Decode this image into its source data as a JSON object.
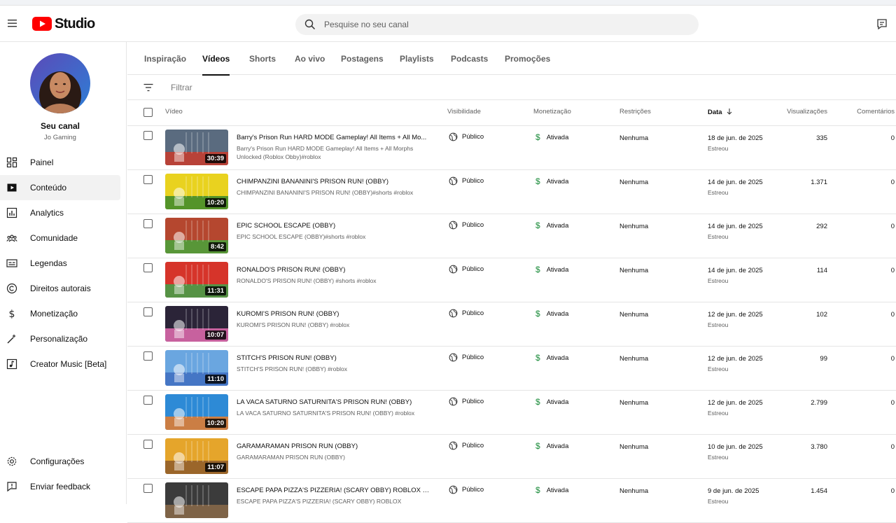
{
  "app": {
    "name": "Studio"
  },
  "search": {
    "placeholder": "Pesquise no seu canal"
  },
  "channel": {
    "title": "Seu canal",
    "name": "Jo Gaming"
  },
  "nav": [
    {
      "label": "Painel",
      "icon": "dashboard-icon"
    },
    {
      "label": "Conteúdo",
      "icon": "content-icon"
    },
    {
      "label": "Analytics",
      "icon": "analytics-icon"
    },
    {
      "label": "Comunidade",
      "icon": "community-icon"
    },
    {
      "label": "Legendas",
      "icon": "subtitles-icon"
    },
    {
      "label": "Direitos autorais",
      "icon": "copyright-icon"
    },
    {
      "label": "Monetização",
      "icon": "dollar-icon"
    },
    {
      "label": "Personalização",
      "icon": "magic-wand-icon"
    },
    {
      "label": "Creator Music [Beta]",
      "icon": "music-icon"
    }
  ],
  "nav_bottom": [
    {
      "label": "Configurações",
      "icon": "gear-icon"
    },
    {
      "label": "Enviar feedback",
      "icon": "feedback-icon"
    }
  ],
  "tabs": [
    "Inspiração",
    "Vídeos",
    "Shorts",
    "Ao vivo",
    "Postagens",
    "Playlists",
    "Podcasts",
    "Promoções"
  ],
  "active_tab": "Vídeos",
  "filter": {
    "placeholder": "Filtrar"
  },
  "columns": {
    "video": "Vídeo",
    "visibility": "Visibilidade",
    "monetization": "Monetização",
    "restrictions": "Restrições",
    "date": "Data",
    "views": "Visualizações",
    "comments": "Comentários"
  },
  "videos": [
    {
      "title": "Barry's Prison Run HARD MODE Gameplay! All Items + All Mo...",
      "desc": "Barry's Prison Run HARD MODE Gameplay! All Items + All Morphs Unlocked (Roblox Obby)#roblox",
      "duration": "30:39",
      "visibility": "Público",
      "monetization": "Ativada",
      "restrictions": "Nenhuma",
      "date": "18 de jun. de 2025",
      "date_sub": "Estreou",
      "views": "335",
      "comments": "0",
      "colors": [
        "#5a6b7f",
        "#c93b2b"
      ]
    },
    {
      "title": "CHIMPANZINI BANANINI'S PRISON RUN! (OBBY)",
      "desc": "CHIMPANZINI BANANINI'S PRISON RUN! (OBBY)#shorts #roblox",
      "duration": "10:20",
      "visibility": "Público",
      "monetization": "Ativada",
      "restrictions": "Nenhuma",
      "date": "14 de jun. de 2025",
      "date_sub": "Estreou",
      "views": "1.371",
      "comments": "0",
      "colors": [
        "#e9d21f",
        "#3a8a2c"
      ]
    },
    {
      "title": "EPIC SCHOOL ESCAPE (OBBY)",
      "desc": "EPIC SCHOOL ESCAPE (OBBY)#shorts #roblox",
      "duration": "8:42",
      "visibility": "Público",
      "monetization": "Ativada",
      "restrictions": "Nenhuma",
      "date": "14 de jun. de 2025",
      "date_sub": "Estreou",
      "views": "292",
      "comments": "0",
      "colors": [
        "#b5472f",
        "#48a53a"
      ]
    },
    {
      "title": "RONALDO'S PRISON RUN! (OBBY)",
      "desc": "RONALDO'S PRISON RUN! (OBBY) #shorts #roblox",
      "duration": "11:31",
      "visibility": "Público",
      "monetization": "Ativada",
      "restrictions": "Nenhuma",
      "date": "14 de jun. de 2025",
      "date_sub": "Estreou",
      "views": "114",
      "comments": "0",
      "colors": [
        "#d6342a",
        "#3fa34a"
      ]
    },
    {
      "title": "KUROMI'S PRISON RUN! (OBBY)",
      "desc": "KUROMI'S PRISON RUN! (OBBY) #roblox",
      "duration": "10:07",
      "visibility": "Público",
      "monetization": "Ativada",
      "restrictions": "Nenhuma",
      "date": "12 de jun. de 2025",
      "date_sub": "Estreou",
      "views": "102",
      "comments": "0",
      "colors": [
        "#2b2438",
        "#e36cb0"
      ]
    },
    {
      "title": "STITCH'S PRISON RUN! (OBBY)",
      "desc": "STITCH'S PRISON RUN! (OBBY) #roblox",
      "duration": "11:10",
      "visibility": "Público",
      "monetization": "Ativada",
      "restrictions": "Nenhuma",
      "date": "12 de jun. de 2025",
      "date_sub": "Estreou",
      "views": "99",
      "comments": "0",
      "colors": [
        "#6aa6e0",
        "#3e6dc0"
      ]
    },
    {
      "title": "LA VACA SATURNO SATURNITA'S PRISON RUN! (OBBY)",
      "desc": "LA VACA SATURNO SATURNITA'S PRISON RUN! (OBBY) #roblox",
      "duration": "10:20",
      "visibility": "Público",
      "monetization": "Ativada",
      "restrictions": "Nenhuma",
      "date": "12 de jun. de 2025",
      "date_sub": "Estreou",
      "views": "2.799",
      "comments": "0",
      "colors": [
        "#2d8ad6",
        "#e77b2a"
      ]
    },
    {
      "title": "GARAMARAMAN PRISON RUN (OBBY)",
      "desc": "GARAMARAMAN PRISON RUN (OBBY)",
      "duration": "11:07",
      "visibility": "Público",
      "monetization": "Ativada",
      "restrictions": "Nenhuma",
      "date": "10 de jun. de 2025",
      "date_sub": "Estreou",
      "views": "3.780",
      "comments": "0",
      "colors": [
        "#e5a52b",
        "#8e5a2a"
      ]
    },
    {
      "title": "ESCAPE PAPA PIZZA'S PIZZERIA! (SCARY OBBY) ROBLOX GA...",
      "desc": "ESCAPE PAPA PIZZA'S PIZZERIA! (SCARY OBBY) ROBLOX",
      "duration": "",
      "visibility": "Público",
      "monetization": "Ativada",
      "restrictions": "Nenhuma",
      "date": "9 de jun. de 2025",
      "date_sub": "Estreou",
      "views": "1.454",
      "comments": "0",
      "colors": [
        "#3b3b3b",
        "#8b6b4a"
      ]
    }
  ]
}
